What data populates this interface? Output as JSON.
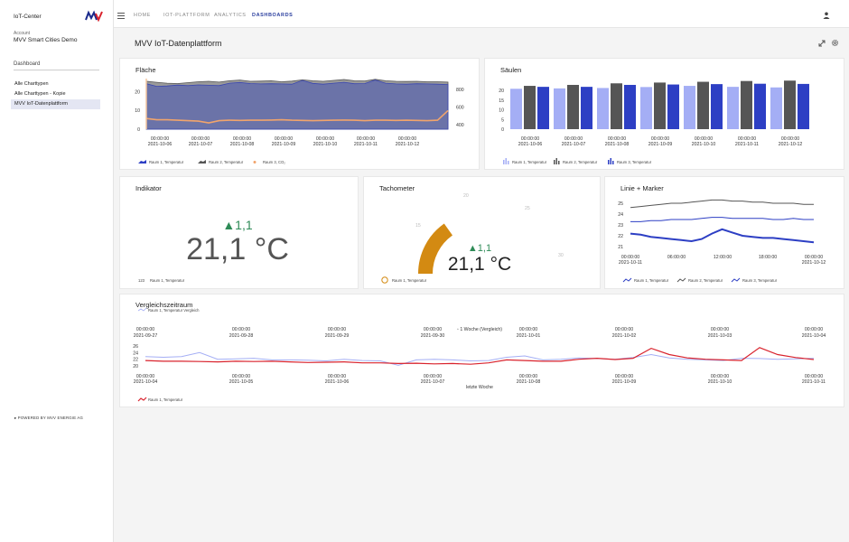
{
  "sidebar": {
    "brand": "IoT-Center",
    "account_label": "Account",
    "account_name": "MVV Smart Cities Demo",
    "section": "Dashboard",
    "items": [
      {
        "label": "Alle Charttypen"
      },
      {
        "label": "Alle Charttypen - Kopie"
      },
      {
        "label": "MVV IoT-Datenplattform"
      }
    ],
    "footer": "POWERED BY MVV ENERGIE AG"
  },
  "nav": {
    "home": "HOME",
    "iot": "IOT-PLATTFORM",
    "analytics": "ANALYTICS",
    "dashboards": "DASHBOARDS"
  },
  "page": {
    "title": "MVV IoT-Datenplattform"
  },
  "colors": {
    "light_blue": "#a4aef5",
    "dark_gray": "#555555",
    "blue": "#2d3fc4",
    "orange": "#f1a46c",
    "gauge": "#d38a12",
    "red": "#d9232d",
    "green": "#2e8b57"
  },
  "flaeche": {
    "title": "Fläche",
    "chart_data": {
      "type": "area",
      "left_axis_ticks": [
        "20",
        "10",
        "0"
      ],
      "right_axis_ticks": [
        "800",
        "600",
        "400"
      ],
      "x_time": "00:00:00",
      "x_dates": [
        "2021-10-06",
        "2021-10-07",
        "2021-10-08",
        "2021-10-09",
        "2021-10-10",
        "2021-10-11",
        "2021-10-12"
      ],
      "series": [
        {
          "name": "Raum 1, Temperatur",
          "values": [
            24.2,
            22.8,
            23.0,
            23.5,
            23.2,
            23.6,
            23.4,
            23.2,
            24.5,
            24.9,
            24.3,
            24.1,
            24.2,
            24.1,
            24.0,
            26.0,
            24.4,
            24.0,
            24.5,
            25.0,
            24.2,
            24.3,
            26.2,
            24.5,
            24.1,
            24.0,
            24.2,
            24.1,
            24.0,
            23.8
          ]
        },
        {
          "name": "Raum 2, Temperatur",
          "values": [
            25.5,
            25.0,
            24.5,
            24.3,
            24.8,
            25.3,
            25.5,
            25.1,
            25.8,
            26.2,
            25.5,
            25.6,
            25.8,
            25.3,
            25.6,
            26.3,
            25.8,
            25.5,
            26.0,
            26.5,
            25.8,
            25.7,
            26.6,
            25.8,
            25.5,
            25.4,
            25.5,
            25.3,
            25.3,
            25.1
          ]
        },
        {
          "name": "Raum 3, CO₂",
          "values": [
            470,
            455,
            455,
            450,
            445,
            440,
            420,
            445,
            450,
            448,
            450,
            450,
            452,
            455,
            450,
            448,
            445,
            448,
            450,
            452,
            450,
            445,
            450,
            450,
            448,
            450,
            448,
            445,
            450,
            560
          ]
        }
      ]
    }
  },
  "saeulen": {
    "title": "Säulen",
    "chart_data": {
      "type": "bar",
      "y_ticks": [
        "20",
        "15",
        "10",
        "5",
        "0"
      ],
      "x_time": "00:00:00",
      "categories": [
        "2021-10-06",
        "2021-10-07",
        "2021-10-08",
        "2021-10-09",
        "2021-10-10",
        "2021-10-11",
        "2021-10-12"
      ],
      "series": [
        {
          "name": "Raum 1, Temperatur",
          "values": [
            20.8,
            21.0,
            21.2,
            21.7,
            22.3,
            21.8,
            21.5
          ]
        },
        {
          "name": "Raum 2, Temperatur",
          "values": [
            22.3,
            22.8,
            23.6,
            24.0,
            24.4,
            24.8,
            25.0
          ]
        },
        {
          "name": "Raum 3, Temperatur",
          "values": [
            21.8,
            21.8,
            22.8,
            23.0,
            23.2,
            23.4,
            23.3
          ]
        }
      ]
    }
  },
  "indikator": {
    "title": "Indikator",
    "delta": "▲1,1",
    "value": "21,1 °C",
    "legend": "Raum 1, Temperatur",
    "legend_badge": "123"
  },
  "tacho": {
    "title": "Tachometer",
    "delta": "▲1,1",
    "value": "21,1 °C",
    "legend": "Raum 1, Temperatur",
    "ticks": [
      "15",
      "20",
      "25",
      "30"
    ],
    "chart_data": {
      "type": "gauge",
      "value": 21.1,
      "min": 10,
      "max": 35
    }
  },
  "linie": {
    "title": "Linie + Marker",
    "chart_data": {
      "type": "line",
      "y_ticks": [
        "25",
        "24",
        "23",
        "22",
        "21"
      ],
      "x_labels": [
        {
          "time": "00:00:00",
          "date": "2021-10-11"
        },
        {
          "time": "06:00:00",
          "date": ""
        },
        {
          "time": "12:00:00",
          "date": ""
        },
        {
          "time": "18:00:00",
          "date": ""
        },
        {
          "time": "00:00:00",
          "date": "2021-10-12"
        }
      ],
      "series": [
        {
          "name": "Raum 1, Temperatur",
          "values": [
            22.2,
            22.1,
            21.9,
            21.8,
            21.7,
            21.6,
            21.5,
            21.7,
            22.2,
            22.6,
            22.3,
            22.0,
            21.9,
            21.8,
            21.8,
            21.7,
            21.6,
            21.5,
            21.4
          ]
        },
        {
          "name": "Raum 2, Temperatur",
          "values": [
            24.6,
            24.7,
            24.8,
            24.9,
            25.0,
            25.0,
            25.1,
            25.2,
            25.3,
            25.3,
            25.2,
            25.2,
            25.1,
            25.1,
            25.0,
            25.0,
            25.0,
            24.9,
            24.9
          ]
        },
        {
          "name": "Raum 3, Temperatur",
          "values": [
            23.3,
            23.3,
            23.4,
            23.4,
            23.5,
            23.5,
            23.5,
            23.6,
            23.7,
            23.7,
            23.6,
            23.6,
            23.6,
            23.6,
            23.5,
            23.5,
            23.6,
            23.5,
            23.5
          ]
        }
      ]
    }
  },
  "vergleich": {
    "title": "Vergleichszeitraum",
    "chart_data": {
      "type": "line",
      "y_ticks": [
        "26",
        "24",
        "22",
        "20"
      ],
      "top_axis_title": "1 Woche (Vergleich)",
      "bottom_axis_title": "letzte Woche",
      "top_time": "00:00:00",
      "top_dates": [
        "2021-09-27",
        "2021-09-28",
        "2021-09-29",
        "2021-09-30",
        "2021-10-01",
        "2021-10-02",
        "2021-10-03",
        "2021-10-04"
      ],
      "bottom_time": "00:00:00",
      "bottom_dates": [
        "2021-10-04",
        "2021-10-05",
        "2021-10-06",
        "2021-10-07",
        "2021-10-08",
        "2021-10-09",
        "2021-10-10",
        "2021-10-11"
      ],
      "series": [
        {
          "name": "Raum 1, Temperatur Vergleich",
          "values": [
            22.8,
            22.6,
            22.8,
            24.0,
            22.0,
            22.1,
            22.3,
            21.8,
            21.8,
            21.7,
            21.5,
            22.0,
            21.6,
            21.5,
            20.2,
            21.8,
            22.0,
            21.8,
            21.5,
            21.6,
            22.6,
            23.0,
            21.8,
            22.0,
            22.4,
            22.2,
            22.0,
            22.5,
            23.4,
            22.4,
            22.0,
            21.8,
            21.6,
            22.3,
            22.2,
            22.0,
            22.1,
            22.3
          ]
        },
        {
          "name": "Raum 1, Temperatur",
          "values": [
            21.6,
            21.4,
            21.4,
            21.3,
            21.2,
            21.4,
            21.3,
            21.4,
            21.2,
            21.0,
            21.1,
            21.2,
            20.9,
            20.9,
            20.7,
            20.8,
            20.6,
            20.7,
            20.5,
            20.9,
            21.8,
            21.6,
            21.4,
            21.4,
            22.0,
            22.3,
            21.9,
            22.3,
            25.3,
            23.4,
            22.4,
            22.0,
            21.8,
            21.6,
            25.5,
            23.4,
            22.5,
            21.9
          ]
        }
      ]
    }
  }
}
